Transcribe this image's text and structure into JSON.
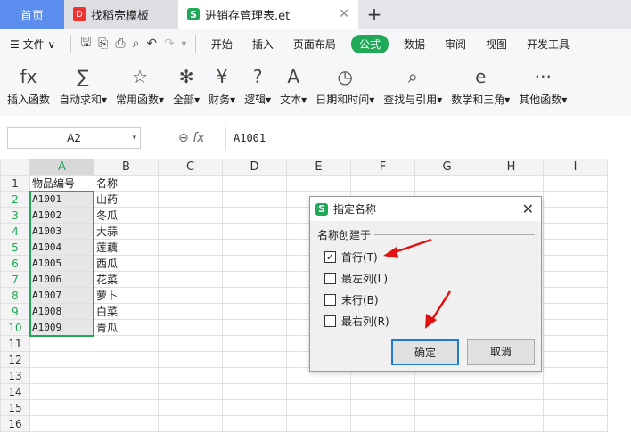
{
  "tabs": [
    {
      "label": "首页"
    },
    {
      "label": "找稻壳模板"
    },
    {
      "label": "进销存管理表.et"
    }
  ],
  "menu": {
    "file": "文件",
    "items": [
      "开始",
      "插入",
      "页面布局",
      "公式",
      "数据",
      "审阅",
      "视图",
      "开发工具"
    ],
    "active": "公式"
  },
  "ribbon": [
    {
      "icon": "fx",
      "label": "插入函数"
    },
    {
      "icon": "∑",
      "label": "自动求和▾"
    },
    {
      "icon": "☆",
      "label": "常用函数▾"
    },
    {
      "icon": "✻",
      "label": "全部▾"
    },
    {
      "icon": "¥",
      "label": "财务▾"
    },
    {
      "icon": "?",
      "label": "逻辑▾"
    },
    {
      "icon": "A",
      "label": "文本▾"
    },
    {
      "icon": "◷",
      "label": "日期和时间▾"
    },
    {
      "icon": "⌕",
      "label": "查找与引用▾"
    },
    {
      "icon": "e",
      "label": "数学和三角▾"
    },
    {
      "icon": "···",
      "label": "其他函数▾"
    }
  ],
  "formula": {
    "cell": "A2",
    "fx": "fx",
    "value": "A1001"
  },
  "columns": [
    "A",
    "B",
    "C",
    "D",
    "E",
    "F",
    "G",
    "H",
    "I"
  ],
  "rows": [
    [
      "物品编号",
      "名称"
    ],
    [
      "A1001",
      "山药"
    ],
    [
      "A1002",
      "冬瓜"
    ],
    [
      "A1003",
      "大蒜"
    ],
    [
      "A1004",
      "莲藕"
    ],
    [
      "A1005",
      "西瓜"
    ],
    [
      "A1006",
      "花菜"
    ],
    [
      "A1007",
      "萝卜"
    ],
    [
      "A1008",
      "白菜"
    ],
    [
      "A1009",
      "青瓜"
    ],
    [
      "",
      ""
    ],
    [
      "",
      ""
    ],
    [
      "",
      ""
    ],
    [
      "",
      ""
    ],
    [
      "",
      ""
    ],
    [
      "",
      ""
    ]
  ],
  "dialog": {
    "title": "指定名称",
    "group": "名称创建于",
    "options": [
      {
        "label": "首行(T)",
        "checked": true
      },
      {
        "label": "最左列(L)",
        "checked": false
      },
      {
        "label": "末行(B)",
        "checked": false
      },
      {
        "label": "最右列(R)",
        "checked": false
      }
    ],
    "ok": "确定",
    "cancel": "取消"
  }
}
